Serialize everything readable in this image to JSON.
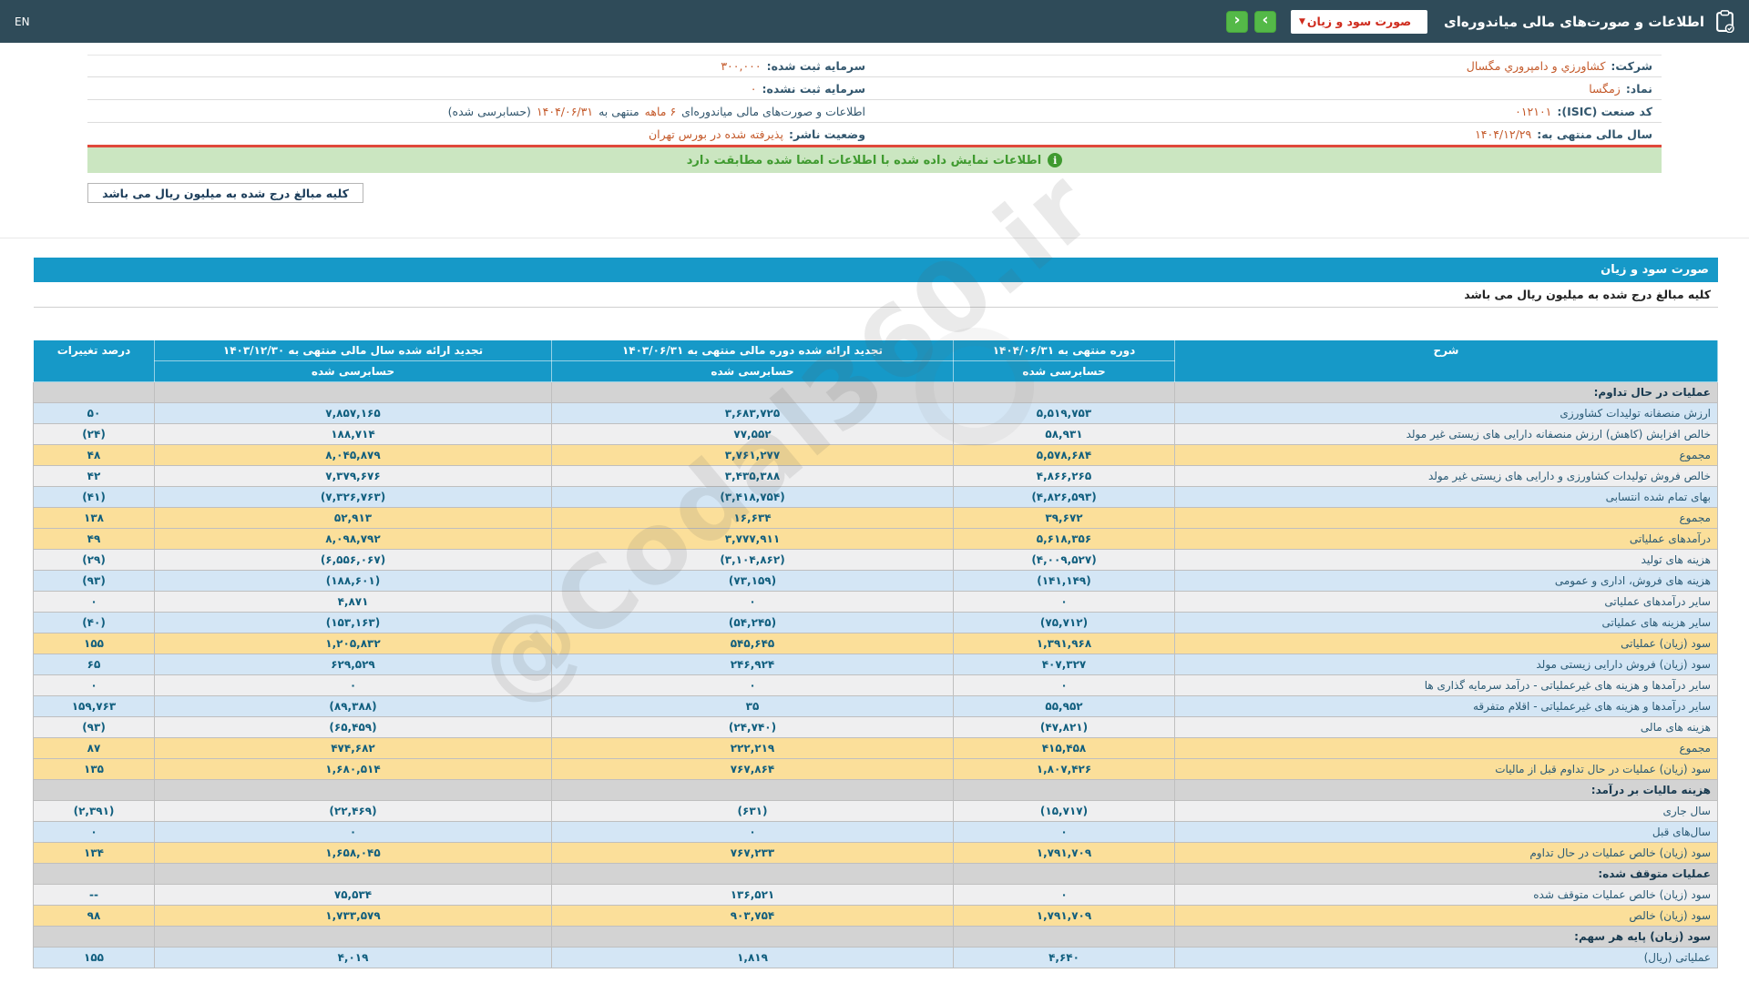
{
  "topbar": {
    "title": "اطلاعات و صورت‌های مالی میاندوره‌ای",
    "statement_select": "صورت سود و زیان",
    "next_glyph": "›",
    "prev_glyph": "‹",
    "lang": "EN"
  },
  "company": {
    "rows": [
      {
        "right_label": "شرکت:",
        "right_value": "کشاورزي و دامپروري مگسال",
        "left_label": "سرمایه ثبت شده:",
        "left_value": "۳۰۰,۰۰۰"
      },
      {
        "right_label": "نماد:",
        "right_value": "زمگسا",
        "left_label": "سرمایه ثبت نشده:",
        "left_value": "۰"
      },
      {
        "right_label": "کد صنعت (ISIC):",
        "right_value": "۰۱۲۱۰۱",
        "left_segments": [
          {
            "t": "اطلاعات و صورت‌های مالی میاندوره‌ای ",
            "hl": false
          },
          {
            "t": "۶ ماهه",
            "hl": true
          },
          {
            "t": " منتهی به ",
            "hl": false
          },
          {
            "t": "۱۴۰۴/۰۶/۳۱",
            "hl": true
          },
          {
            "t": "(حسابرسی شده)",
            "hl": false
          }
        ]
      },
      {
        "right_label": "سال مالی منتهی به:",
        "right_value": "۱۴۰۴/۱۲/۲۹",
        "left_label": "وضعیت ناشر:",
        "left_value": "پذیرفته شده در بورس تهران"
      }
    ]
  },
  "notice": "اطلاعات نمایش داده شده با اطلاعات امضا شده مطابقت دارد",
  "amounts_note": "کلیه مبالغ درج شده به میلیون ریال می باشد",
  "section_title": "صورت سود و زیان",
  "table": {
    "headers": {
      "desc": "شرح",
      "col1": "دوره منتهی به ۱۴۰۴/۰۶/۳۱",
      "col2": "تجدید ارائه شده دوره مالی منتهی به ۱۴۰۳/۰۶/۳۱",
      "col3": "تجدید ارائه شده سال مالی منتهی به ۱۴۰۳/۱۲/۳۰",
      "audited": "حسابرسی شده",
      "pct": "درصد تغییرات"
    },
    "rows": [
      {
        "type": "section",
        "label": "عملیات در حال تداوم:"
      },
      {
        "type": "data",
        "bg": "blue",
        "label": "ارزش منصفانه تولیدات کشاورزی",
        "v1": "۵,۵۱۹,۷۵۳",
        "v2": "۳,۶۸۳,۷۲۵",
        "v3": "۷,۸۵۷,۱۶۵",
        "pct": "۵۰"
      },
      {
        "type": "data",
        "bg": "white",
        "label": "خالص افزایش (کاهش) ارزش منصفانه دارایی های زیستی غیر مولد",
        "v1": "۵۸,۹۳۱",
        "v2": "۷۷,۵۵۲",
        "v3": "۱۸۸,۷۱۴",
        "pct": "(۲۴)"
      },
      {
        "type": "data",
        "bg": "yellow",
        "label": "مجموع",
        "v1": "۵,۵۷۸,۶۸۴",
        "v2": "۳,۷۶۱,۲۷۷",
        "v3": "۸,۰۴۵,۸۷۹",
        "pct": "۴۸"
      },
      {
        "type": "data",
        "bg": "white",
        "label": "خالص فروش تولیدات کشاورزی و دارایی های زیستی غیر مولد",
        "v1": "۴,۸۶۶,۲۶۵",
        "v2": "۳,۴۳۵,۳۸۸",
        "v3": "۷,۳۷۹,۶۷۶",
        "pct": "۴۲"
      },
      {
        "type": "data",
        "bg": "blue",
        "label": "بهای تمام شده انتسابی",
        "v1": "(۴,۸۲۶,۵۹۳)",
        "v2": "(۳,۴۱۸,۷۵۴)",
        "v3": "(۷,۳۲۶,۷۶۳)",
        "pct": "(۴۱)"
      },
      {
        "type": "data",
        "bg": "yellow",
        "label": "مجموع",
        "v1": "۳۹,۶۷۲",
        "v2": "۱۶,۶۳۴",
        "v3": "۵۲,۹۱۳",
        "pct": "۱۳۸"
      },
      {
        "type": "data",
        "bg": "yellow",
        "label": "درآمدهای عملیاتی",
        "v1": "۵,۶۱۸,۳۵۶",
        "v2": "۳,۷۷۷,۹۱۱",
        "v3": "۸,۰۹۸,۷۹۲",
        "pct": "۴۹"
      },
      {
        "type": "data",
        "bg": "white",
        "label": "هزینه های تولید",
        "v1": "(۴,۰۰۹,۵۲۷)",
        "v2": "(۳,۱۰۴,۸۶۲)",
        "v3": "(۶,۵۵۶,۰۶۷)",
        "pct": "(۲۹)"
      },
      {
        "type": "data",
        "bg": "blue",
        "label": "هزینه های فروش، اداری و عمومی",
        "v1": "(۱۴۱,۱۴۹)",
        "v2": "(۷۳,۱۵۹)",
        "v3": "(۱۸۸,۶۰۱)",
        "pct": "(۹۳)"
      },
      {
        "type": "data",
        "bg": "white",
        "label": "سایر درآمدهای عملیاتی",
        "v1": "۰",
        "v2": "۰",
        "v3": "۴,۸۷۱",
        "pct": "۰"
      },
      {
        "type": "data",
        "bg": "blue",
        "label": "سایر هزینه های عملیاتی",
        "v1": "(۷۵,۷۱۲)",
        "v2": "(۵۴,۲۴۵)",
        "v3": "(۱۵۳,۱۶۳)",
        "pct": "(۴۰)"
      },
      {
        "type": "data",
        "bg": "yellow",
        "label": "سود (زیان) عملیاتی",
        "v1": "۱,۳۹۱,۹۶۸",
        "v2": "۵۴۵,۶۴۵",
        "v3": "۱,۲۰۵,۸۳۲",
        "pct": "۱۵۵"
      },
      {
        "type": "data",
        "bg": "blue",
        "label": "سود (زیان) فروش دارایی زیستی مولد",
        "v1": "۴۰۷,۳۲۷",
        "v2": "۲۴۶,۹۲۴",
        "v3": "۶۲۹,۵۲۹",
        "pct": "۶۵"
      },
      {
        "type": "data",
        "bg": "white",
        "label": "سایر درآمدها و هزینه های غیرعملیاتی - درآمد سرمایه گذاری ها",
        "v1": "۰",
        "v2": "۰",
        "v3": "۰",
        "pct": "۰"
      },
      {
        "type": "data",
        "bg": "blue",
        "label": "سایر درآمدها و هزینه های غیرعملیاتی - اقلام متفرقه",
        "v1": "۵۵,۹۵۲",
        "v2": "۳۵",
        "v3": "(۸۹,۳۸۸)",
        "pct": "۱۵۹,۷۶۳"
      },
      {
        "type": "data",
        "bg": "white",
        "label": "هزینه های مالی",
        "v1": "(۴۷,۸۲۱)",
        "v2": "(۲۴,۷۴۰)",
        "v3": "(۶۵,۴۵۹)",
        "pct": "(۹۳)"
      },
      {
        "type": "data",
        "bg": "yellow",
        "label": "مجموع",
        "v1": "۴۱۵,۴۵۸",
        "v2": "۲۲۲,۲۱۹",
        "v3": "۴۷۴,۶۸۲",
        "pct": "۸۷"
      },
      {
        "type": "data",
        "bg": "yellow",
        "label": "سود (زیان) عملیات در حال تداوم قبل از مالیات",
        "v1": "۱,۸۰۷,۴۲۶",
        "v2": "۷۶۷,۸۶۴",
        "v3": "۱,۶۸۰,۵۱۴",
        "pct": "۱۳۵"
      },
      {
        "type": "section",
        "label": "هزینه مالیات بر درآمد:"
      },
      {
        "type": "data",
        "bg": "white",
        "label": "سال جاری",
        "v1": "(۱۵,۷۱۷)",
        "v2": "(۶۳۱)",
        "v3": "(۲۲,۴۶۹)",
        "pct": "(۲,۳۹۱)"
      },
      {
        "type": "data",
        "bg": "blue",
        "label": "سال‌های قبل",
        "v1": "۰",
        "v2": "۰",
        "v3": "۰",
        "pct": "۰"
      },
      {
        "type": "data",
        "bg": "yellow",
        "label": "سود (زیان) خالص عملیات در حال تداوم",
        "v1": "۱,۷۹۱,۷۰۹",
        "v2": "۷۶۷,۲۳۳",
        "v3": "۱,۶۵۸,۰۴۵",
        "pct": "۱۳۴"
      },
      {
        "type": "section",
        "label": "عملیات متوقف شده:"
      },
      {
        "type": "data",
        "bg": "white",
        "label": "سود (زیان) خالص عملیات متوقف شده",
        "v1": "۰",
        "v2": "۱۳۶,۵۲۱",
        "v3": "۷۵,۵۳۴",
        "pct": "--"
      },
      {
        "type": "data",
        "bg": "yellow",
        "label": "سود (زیان) خالص",
        "v1": "۱,۷۹۱,۷۰۹",
        "v2": "۹۰۳,۷۵۴",
        "v3": "۱,۷۳۳,۵۷۹",
        "pct": "۹۸"
      },
      {
        "type": "section",
        "label": "سود (زیان) پایه هر سهم:"
      },
      {
        "type": "data",
        "bg": "blue",
        "label": "عملیاتی (ریال)",
        "v1": "۴,۶۴۰",
        "v2": "۱,۸۱۹",
        "v3": "۴,۰۱۹",
        "pct": "۱۵۵"
      }
    ]
  },
  "watermark": "@Codal360.ir"
}
